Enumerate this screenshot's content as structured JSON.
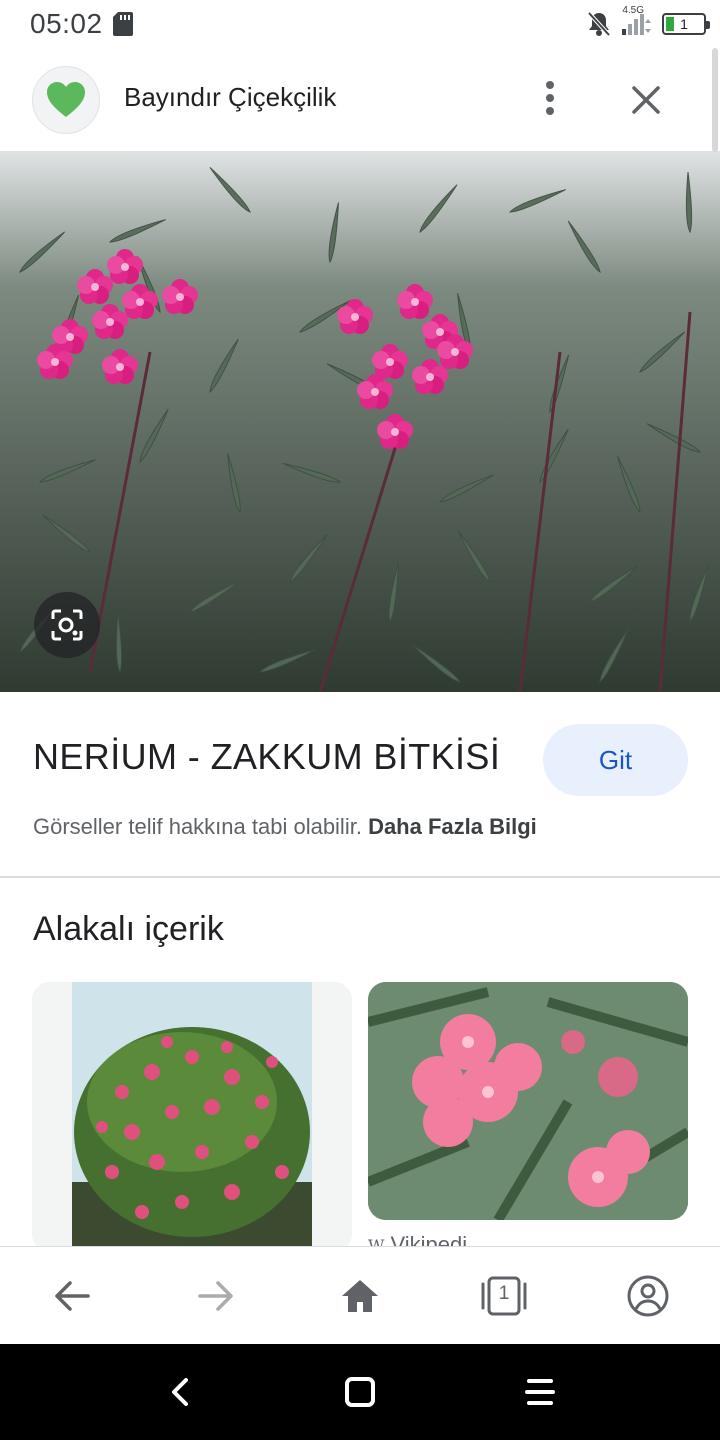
{
  "status_bar": {
    "time": "05:02",
    "network": "4.5G",
    "battery_level": "1"
  },
  "header": {
    "site_name": "Bayındır Çiçekçilik"
  },
  "image": {
    "title": "NERİUM - ZAKKUM BİTKİSİ",
    "visit_label": "Git",
    "copyright_text": "Görseller telif hakkına tabi olabilir.",
    "more_info_label": "Daha Fazla Bilgi"
  },
  "related": {
    "heading": "Alakalı içerik",
    "cards": [
      {
        "source": ""
      },
      {
        "source": "Vikipedi",
        "source_icon": "W"
      }
    ]
  },
  "bottom_nav": {
    "tab_count": "1"
  },
  "colors": {
    "accent": "#1a56c4",
    "button_bg": "#e8f0fe",
    "flower_pink": "#e0278a"
  }
}
